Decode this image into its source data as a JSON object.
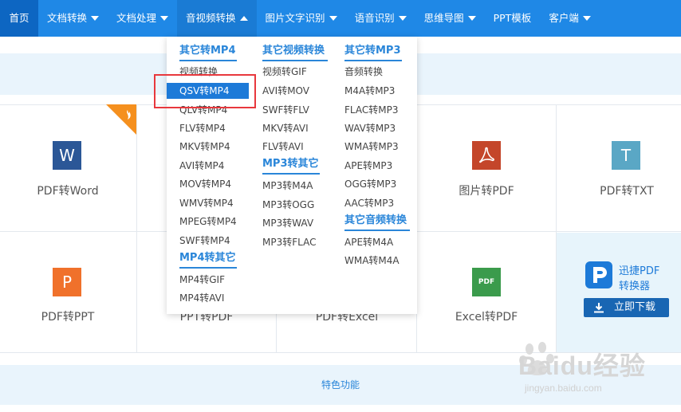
{
  "nav": {
    "home": "首页",
    "items": [
      {
        "label": "文档转换"
      },
      {
        "label": "文档处理"
      },
      {
        "label": "音视频转换"
      },
      {
        "label": "图片文字识别"
      },
      {
        "label": "语音识别"
      },
      {
        "label": "思维导图"
      },
      {
        "label": "PPT模板"
      },
      {
        "label": "客户端"
      }
    ]
  },
  "dropdown": {
    "col1": {
      "title": "其它转MP4",
      "items": [
        "视频转换",
        "QSV转MP4",
        "QLV转MP4",
        "FLV转MP4",
        "MKV转MP4",
        "AVI转MP4",
        "MOV转MP4",
        "WMV转MP4",
        "MPEG转MP4",
        "SWF转MP4"
      ],
      "title2": "MP4转其它",
      "items2": [
        "MP4转GIF",
        "MP4转AVI"
      ]
    },
    "col2": {
      "title": "其它视频转换",
      "items": [
        "视频转GIF",
        "AVI转MOV",
        "SWF转FLV",
        "MKV转AVI",
        "FLV转AVI"
      ],
      "title2": "MP3转其它",
      "items2": [
        "MP3转M4A",
        "MP3转OGG",
        "MP3转WAV",
        "MP3转FLAC"
      ]
    },
    "col3": {
      "title": "其它转MP3",
      "items": [
        "音频转换",
        "M4A转MP3",
        "FLAC转MP3",
        "WAV转MP3",
        "WMA转MP3",
        "APE转MP3",
        "OGG转MP3",
        "AAC转MP3"
      ],
      "title2": "其它音频转换",
      "items2": [
        "APE转M4A",
        "WMA转M4A"
      ]
    }
  },
  "tools": {
    "pdf_word": {
      "label": "PDF转Word",
      "glyph": "W",
      "color": "#2b5797"
    },
    "img_pdf": {
      "label": "图片转PDF",
      "color": "#c4462a"
    },
    "pdf_txt": {
      "label": "PDF转TXT",
      "glyph": "T",
      "color": "#5aa7c5"
    },
    "pdf_ppt": {
      "label": "PDF转PPT",
      "glyph": "P",
      "color": "#f0712b"
    },
    "ppt_pdf": {
      "label": "PPT转PDF"
    },
    "pdf_excel": {
      "label": "PDF转Excel"
    },
    "excel_pdf": {
      "label": "Excel转PDF",
      "glyph": "PDF",
      "color": "#3b9b4c"
    }
  },
  "promo": {
    "title_line1": "迅捷PDF",
    "title_line2": "转换器",
    "button": "立即下载",
    "brand_color": "#1d7ad8"
  },
  "footer": {
    "feature_label": "特色功能"
  },
  "watermark": {
    "brand": "Baidu经验",
    "url": "jingyan.baidu.com"
  }
}
